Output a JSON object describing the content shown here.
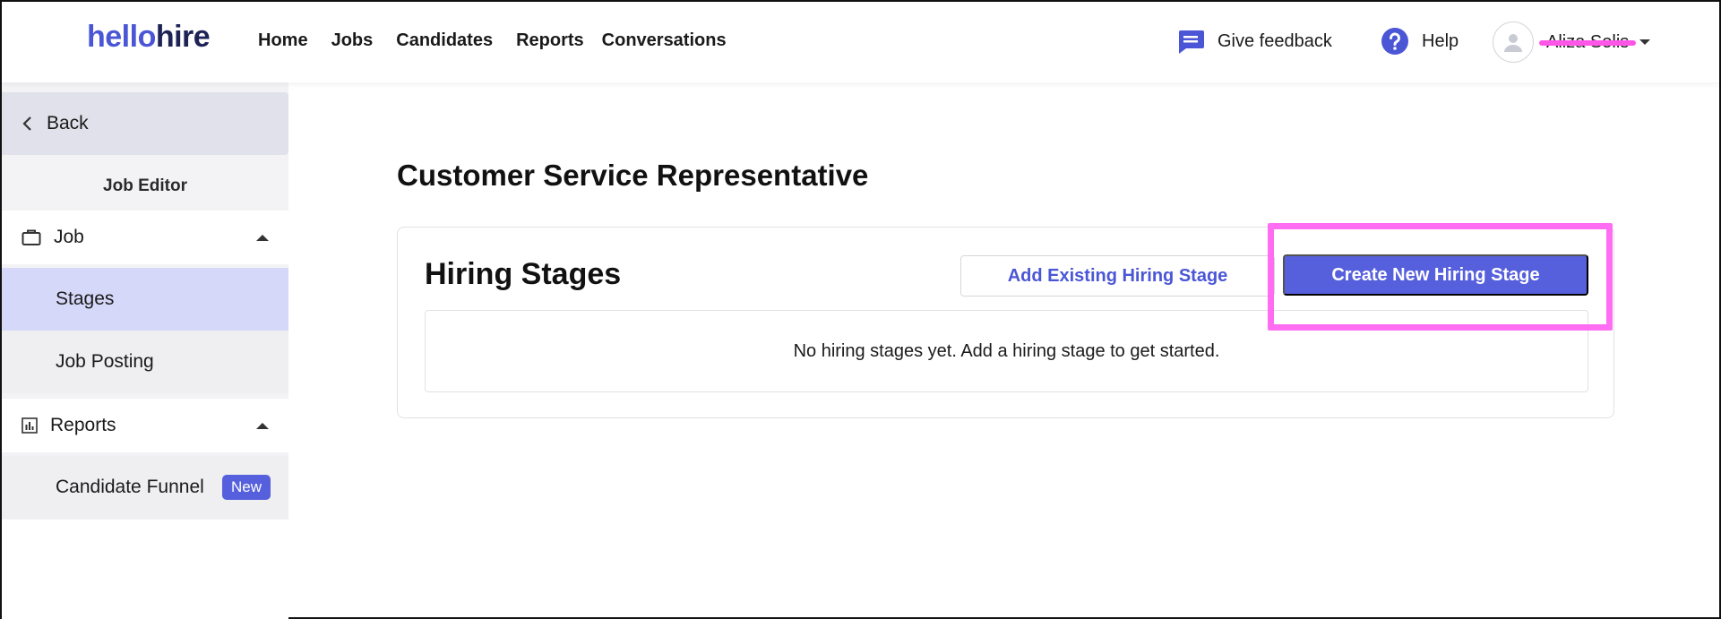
{
  "header": {
    "logo_part1": "hello",
    "logo_part2": "hire",
    "nav": [
      "Home",
      "Jobs",
      "Candidates",
      "Reports",
      "Conversations"
    ],
    "feedback_label": "Give feedback",
    "help_label": "Help",
    "user_name": "Aliza Solis",
    "accent_color": "#4a56d6"
  },
  "sidebar": {
    "back_label": "Back",
    "section_title": "Job Editor",
    "job_group_label": "Job",
    "stages_label": "Stages",
    "job_posting_label": "Job Posting",
    "reports_group_label": "Reports",
    "candidate_funnel_label": "Candidate Funnel",
    "new_badge": "New"
  },
  "main": {
    "page_title": "Customer Service Representative",
    "card_title": "Hiring Stages",
    "add_existing_label": "Add Existing Hiring Stage",
    "create_new_label": "Create New Hiring Stage",
    "empty_message": "No hiring stages yet. Add a hiring stage to get started."
  },
  "colors": {
    "primary_button": "#5660dc",
    "highlight_outline": "#ff6ef2",
    "active_sidebar": "#d6d8fa"
  }
}
